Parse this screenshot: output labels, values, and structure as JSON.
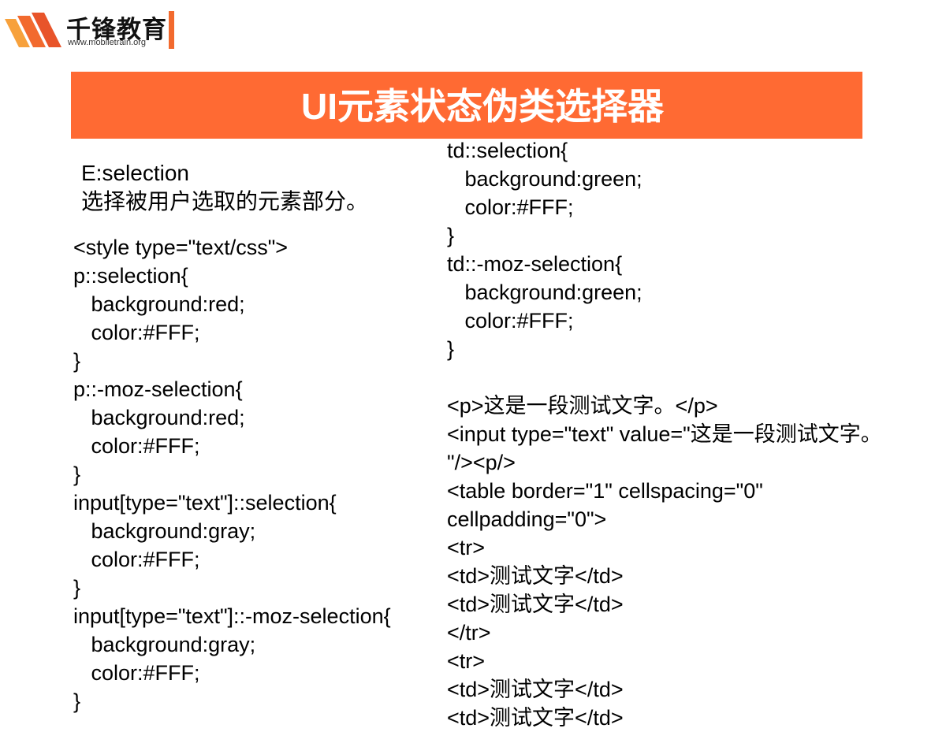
{
  "logo": {
    "name": "千锋教育",
    "url": "www.mobiletrain.org",
    "colors": {
      "primary": "#f26a2e",
      "secondary": "#f7a13c"
    }
  },
  "title": {
    "text": "UI元素状态伪类选择器",
    "background": "#ff6a33",
    "color": "#ffffff"
  },
  "description": {
    "selector": "E:selection",
    "text": "选择被用户选取的元素部分。"
  },
  "code_left": [
    "<style type=\"text/css\">",
    "p::selection{",
    "   background:red;",
    "   color:#FFF;",
    "}",
    "p::-moz-selection{",
    "   background:red;",
    "   color:#FFF;",
    "}",
    "input[type=\"text\"]::selection{",
    "   background:gray;",
    "   color:#FFF;",
    "}",
    "input[type=\"text\"]::-moz-selection{",
    "   background:gray;",
    "   color:#FFF;",
    "}"
  ],
  "code_right": [
    "td::selection{",
    "   background:green;",
    "   color:#FFF;",
    "}",
    "td::-moz-selection{",
    "   background:green;",
    "   color:#FFF;",
    "}",
    "",
    "<p>这是一段测试文字。</p>",
    "<input type=\"text\" value=\"这是一段测试文字。",
    "\"/><p/>",
    "<table border=\"1\" cellspacing=\"0\"",
    "cellpadding=\"0\">",
    "<tr>",
    "<td>测试文字</td>",
    "<td>测试文字</td>",
    "</tr>",
    "<tr>",
    "<td>测试文字</td>",
    "<td>测试文字</td>"
  ]
}
